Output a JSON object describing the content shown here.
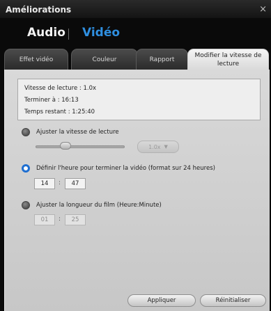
{
  "window": {
    "title": "Améliorations",
    "close_glyph": "×"
  },
  "modes": {
    "audio": "Audio",
    "video": "Vidéo"
  },
  "tabs": [
    {
      "label": "Effet vidéo"
    },
    {
      "label": "Couleur"
    },
    {
      "label": "Rapport"
    },
    {
      "label": "Modifier la vitesse de lecture",
      "active": true
    }
  ],
  "info": {
    "speed": "Vitesse de lecture : 1.0x",
    "finish": "Terminer à : 16:13",
    "remaining": "Temps restant : 1:25:40"
  },
  "options": {
    "adjust_speed": {
      "label": "Ajuster la vitesse de lecture",
      "selected": false,
      "speed_value": "1.0x"
    },
    "end_time": {
      "label": "Définir l'heure pour terminer la vidéo (format sur 24 heures)",
      "selected": true,
      "hour": "14",
      "minute": "47"
    },
    "length": {
      "label": "Ajuster la longueur du film (Heure:Minute)",
      "selected": false,
      "hour": "01",
      "minute": "25"
    }
  },
  "buttons": {
    "apply": "Appliquer",
    "reset": "Réinitialiser"
  },
  "colors": {
    "accent": "#2f8fe0",
    "radio_selected": "#1f6fd1"
  }
}
